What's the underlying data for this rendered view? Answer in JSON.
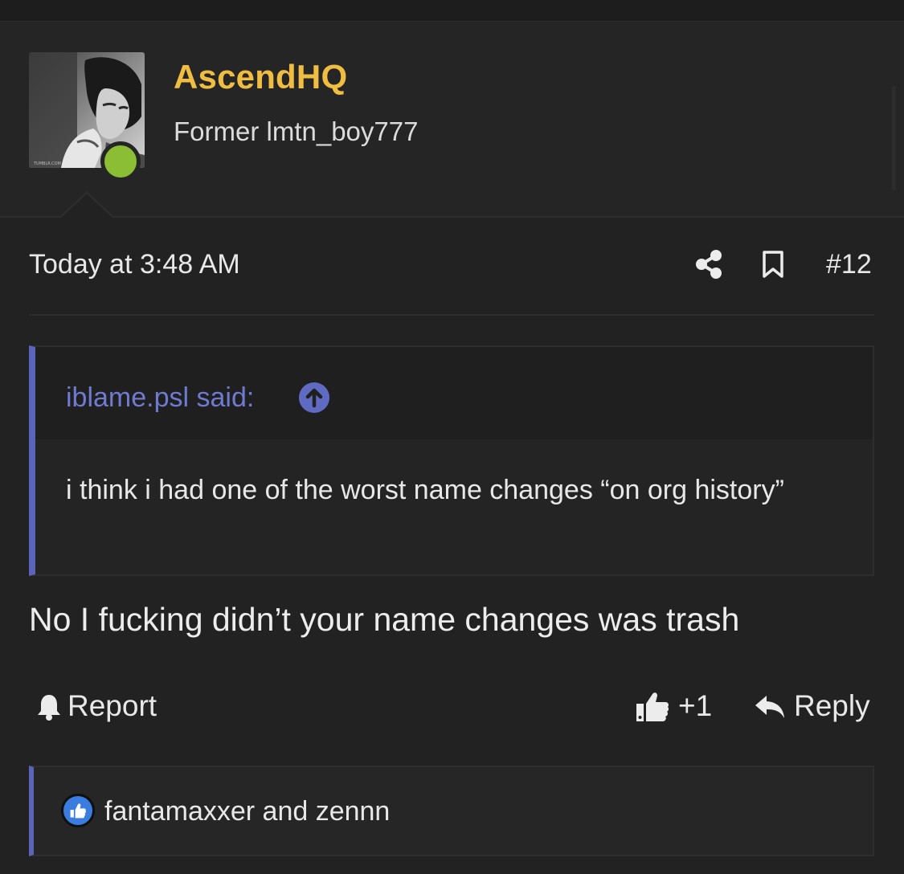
{
  "author": {
    "username": "AscendHQ",
    "user_title": "Former lmtn_boy777",
    "avatar_icon": "avatar-photo",
    "online_status": "online",
    "colors": {
      "username": "#f0bd43",
      "online": "#8bbd35"
    }
  },
  "post": {
    "timestamp": "Today at 3:48 AM",
    "post_number": "#12",
    "actions": {
      "share_icon": "share-icon",
      "bookmark_icon": "bookmark-icon"
    }
  },
  "quote": {
    "author_label": "iblame.psl said:",
    "jump_icon": "arrow-up-circle-icon",
    "text": "i think i had one of the worst name changes “on org history”",
    "accent_color": "#5b64b8"
  },
  "message": {
    "text": "No I fucking didn’t your name changes was trash"
  },
  "footer": {
    "report_label": "Report",
    "like_count": "+1",
    "reply_label": "Reply"
  },
  "reactions": {
    "icon": "like-reaction-icon",
    "users_text": "fantamaxxer and zennn"
  }
}
